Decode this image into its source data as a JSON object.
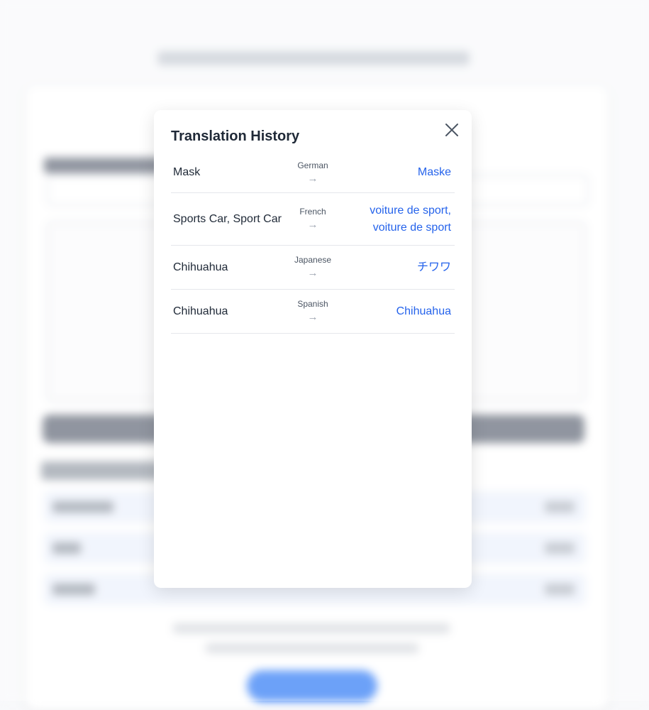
{
  "modal": {
    "title": "Translation History",
    "close_icon": "close-icon",
    "arrow_glyph": "→"
  },
  "history": [
    {
      "source": "Mask",
      "language": "German",
      "translation": [
        "Maske"
      ]
    },
    {
      "source": "Sports Car, Sport Car",
      "language": "French",
      "translation": [
        "voiture de sport,",
        "voiture de sport"
      ]
    },
    {
      "source": "Chihuahua",
      "language": "Japanese",
      "translation": [
        "チワワ"
      ]
    },
    {
      "source": "Chihuahua",
      "language": "Spanish",
      "translation": [
        "Chihuahua"
      ]
    }
  ],
  "colors": {
    "accent": "#2563eb",
    "text": "#1f2937",
    "muted": "#4b5563",
    "divider": "#e5e7eb"
  }
}
